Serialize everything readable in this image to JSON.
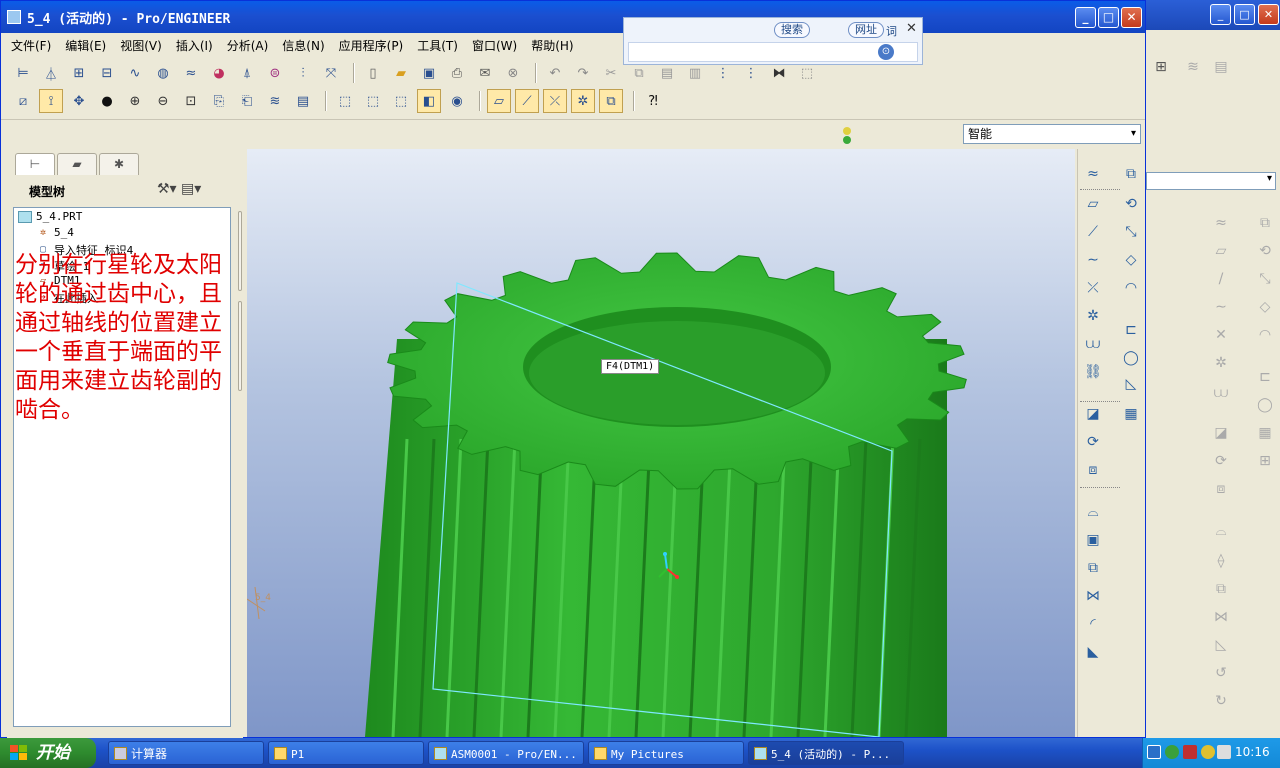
{
  "window": {
    "title": "5_4 (活动的) - Pro/ENGINEER",
    "min_label": "_",
    "max_label": "□",
    "close_label": "✕"
  },
  "menu": [
    "文件(F)",
    "编辑(E)",
    "视图(V)",
    "插入(I)",
    "分析(A)",
    "信息(N)",
    "应用程序(P)",
    "工具(T)",
    "窗口(W)",
    "帮助(H)"
  ],
  "search_bar": {
    "search_label": "搜索",
    "url_label": "网址",
    "word_label": "词",
    "close_label": "✕"
  },
  "smart_filter": {
    "value": "智能"
  },
  "left_panel": {
    "title": "模型树",
    "tree": [
      {
        "label": "5_4.PRT",
        "icon": "part-icon"
      },
      {
        "label": "5_4",
        "icon": "csys-icon"
      },
      {
        "label": "导入特征 标识4",
        "icon": "import-feature-icon"
      },
      {
        "label": "草绘 1",
        "icon": "sketch-icon"
      },
      {
        "label": "DTM1",
        "icon": "datum-plane-icon"
      },
      {
        "label": "在此插入",
        "icon": "insert-here-arrow-icon"
      }
    ],
    "note": "分别在行星轮及太阳轮的通过齿中心，且通过轴线的位置建立一个垂直于端面的平面用来建立齿轮副的啮合。"
  },
  "viewport": {
    "datum_label": "F4(DTM1)",
    "csys_label": "5_4",
    "colors": {
      "gear": "#2fb52f",
      "datum": "#7fe8ff",
      "bg_top": "#e6ecf6",
      "bg_bottom": "#7f96c8"
    }
  },
  "taskbar": {
    "start_label": "开始",
    "tasks": [
      "计算器",
      "P1",
      "ASM0001 - Pro/EN...",
      "My Pictures",
      "5_4 (活动的) - P..."
    ],
    "clock": "10:16"
  }
}
